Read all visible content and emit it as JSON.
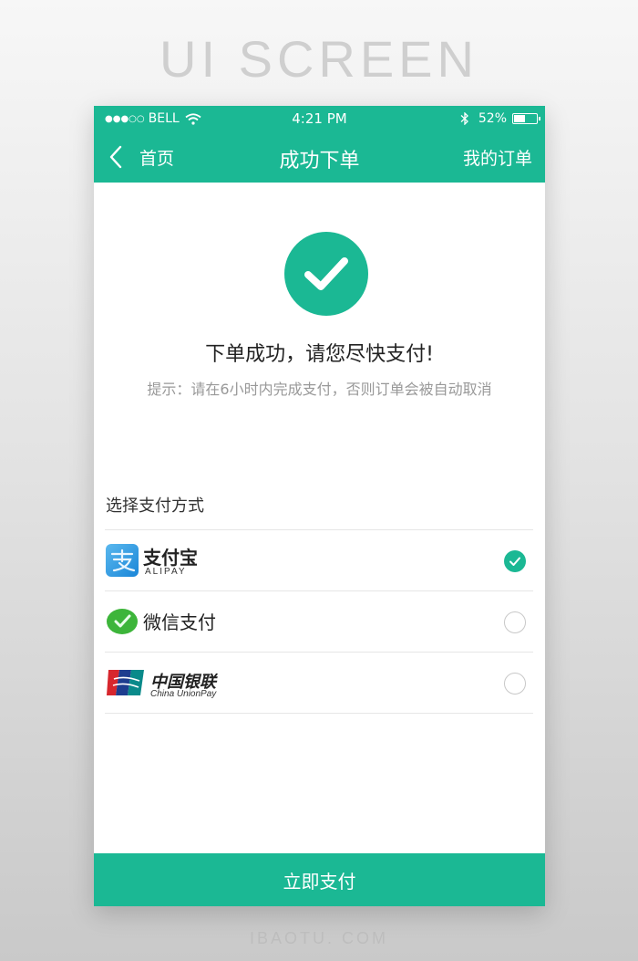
{
  "page": {
    "top_title": "UI SCREEN",
    "bottom_brand": "IBAOTU. COM"
  },
  "status_bar": {
    "signal": "●●●○○",
    "carrier": "BELL",
    "time": "4:21 PM",
    "battery_percent": "52%",
    "battery_level": 0.52
  },
  "nav": {
    "back_label": "首页",
    "title": "成功下单",
    "right_link": "我的订单"
  },
  "success": {
    "title": "下单成功，请您尽快支付!",
    "tip": "提示：请在6小时内完成支付，否则订单会被自动取消"
  },
  "payment": {
    "section_label": "选择支付方式",
    "methods": [
      {
        "name": "支付宝",
        "sub": "ALIPAY",
        "icon": "alipay-logo",
        "selected": true
      },
      {
        "name": "微信支付",
        "sub": "",
        "icon": "wechat-pay-logo",
        "selected": false
      },
      {
        "name": "中国银联",
        "sub": "China UnionPay",
        "icon": "unionpay-logo",
        "selected": false
      }
    ]
  },
  "pay_button": "立即支付",
  "colors": {
    "accent": "#1bb894",
    "divider": "#e6e6e6",
    "hint_text": "#999999"
  }
}
